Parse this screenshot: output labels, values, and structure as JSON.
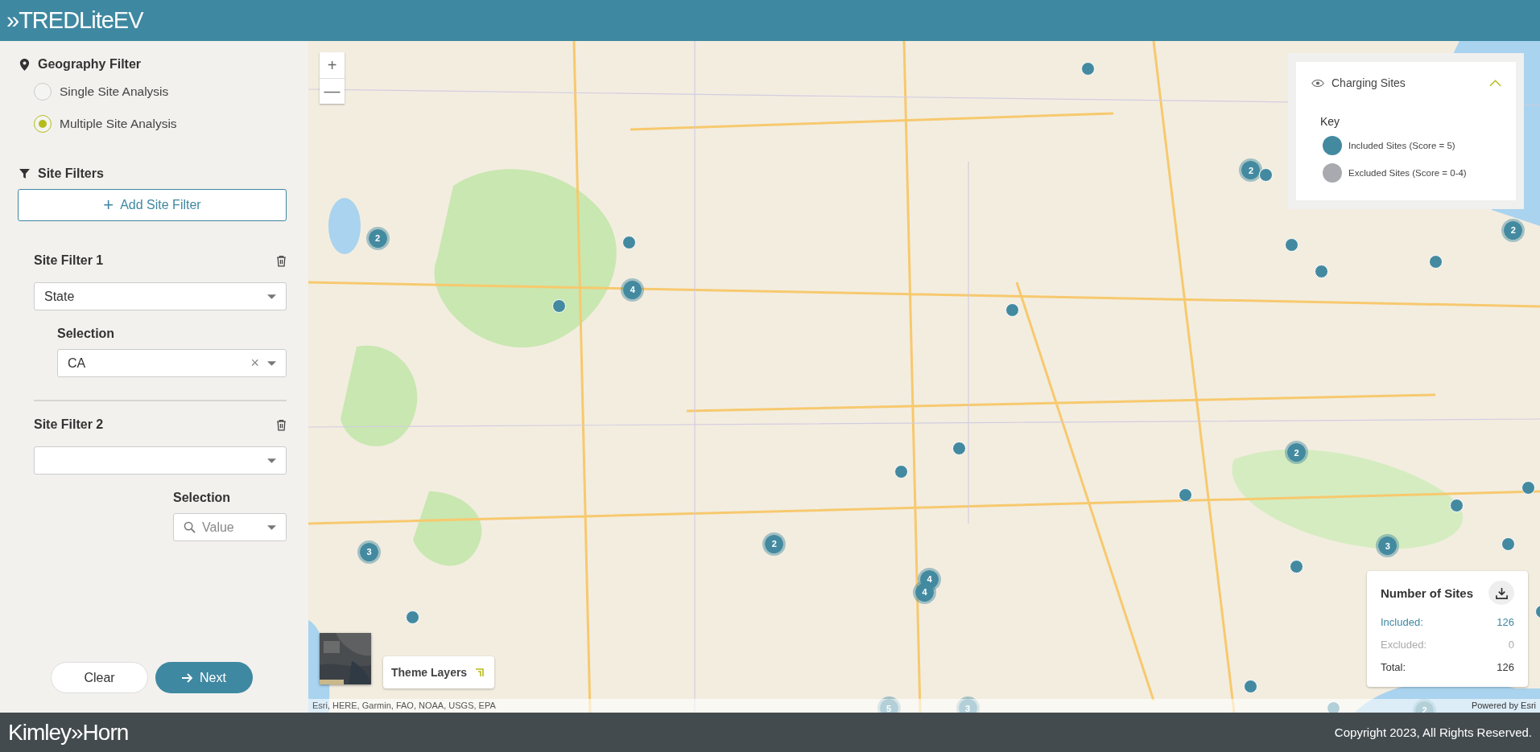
{
  "header": {
    "logo_mark": "»",
    "logo_main": "TREDLite",
    "logo_suffix": "EV"
  },
  "sidebar": {
    "geography_filter": {
      "title": "Geography Filter",
      "options": [
        {
          "label": "Single Site Analysis",
          "selected": false
        },
        {
          "label": "Multiple Site Analysis",
          "selected": true
        }
      ]
    },
    "site_filters": {
      "title": "Site Filters",
      "add_button": {
        "icon": "+",
        "label": "Add Site Filter"
      },
      "filters": [
        {
          "title": "Site Filter 1",
          "field": {
            "value": "State"
          },
          "selection_label": "Selection",
          "selection": {
            "value": "CA",
            "clear": "×"
          }
        },
        {
          "title": "Site Filter 2",
          "selection_label": "Selection",
          "selection": {
            "placeholder": "Value"
          }
        }
      ]
    },
    "buttons": [
      {
        "kind": "secondary",
        "label": "Clear"
      },
      {
        "kind": "primary",
        "label": "Next"
      }
    ]
  },
  "map": {
    "zoom_in": "+",
    "zoom_out": "—",
    "markers": [
      {
        "kind": "site"
      },
      {
        "kind": "cluster",
        "count": "2"
      },
      {
        "kind": "site"
      },
      {
        "kind": "cluster",
        "count": "4"
      },
      {
        "kind": "site"
      },
      {
        "kind": "cluster",
        "count": "2"
      },
      {
        "kind": "site"
      },
      {
        "kind": "site"
      },
      {
        "kind": "site"
      },
      {
        "kind": "site"
      },
      {
        "kind": "cluster",
        "count": "2"
      },
      {
        "kind": "site"
      },
      {
        "kind": "site"
      },
      {
        "kind": "site"
      },
      {
        "kind": "cluster",
        "count": "2"
      },
      {
        "kind": "site"
      },
      {
        "kind": "site"
      },
      {
        "kind": "site"
      },
      {
        "kind": "site"
      },
      {
        "kind": "cluster",
        "count": "3"
      },
      {
        "kind": "site"
      },
      {
        "kind": "cluster",
        "count": "2"
      },
      {
        "kind": "cluster",
        "count": "3"
      },
      {
        "kind": "cluster",
        "count": "4"
      },
      {
        "kind": "cluster",
        "count": "4"
      },
      {
        "kind": "site"
      },
      {
        "kind": "site"
      },
      {
        "kind": "site"
      },
      {
        "kind": "cluster",
        "count": "5"
      },
      {
        "kind": "cluster",
        "count": "3"
      },
      {
        "kind": "cluster",
        "count": "2"
      },
      {
        "kind": "site"
      }
    ],
    "legend": {
      "title": "Charging Sites",
      "key_label": "Key",
      "items": [
        {
          "label": "Included Sites (Score = 5)",
          "color": "#438aa0"
        },
        {
          "label": "Excluded Sites (Score = 0-4)",
          "color": "#a9a9b0"
        }
      ]
    },
    "theme_layers": {
      "label": "Theme Layers"
    },
    "site_counts": {
      "title": "Number of Sites",
      "rows": [
        {
          "kind": "included",
          "label": "Included:",
          "value": "126"
        },
        {
          "kind": "excluded",
          "label": "Excluded:",
          "value": "0"
        },
        {
          "kind": "total",
          "label": "Total:",
          "value": "126"
        }
      ]
    },
    "attribution": "Esri, HERE, Garmin, FAO, NOAA, USGS, EPA",
    "powered_by": "Powered by Esri"
  },
  "footer": {
    "logo_left": "Kimley",
    "logo_mark": "»",
    "logo_right": "Horn",
    "copyright": "Copyright 2023, All Rights Reserved."
  }
}
